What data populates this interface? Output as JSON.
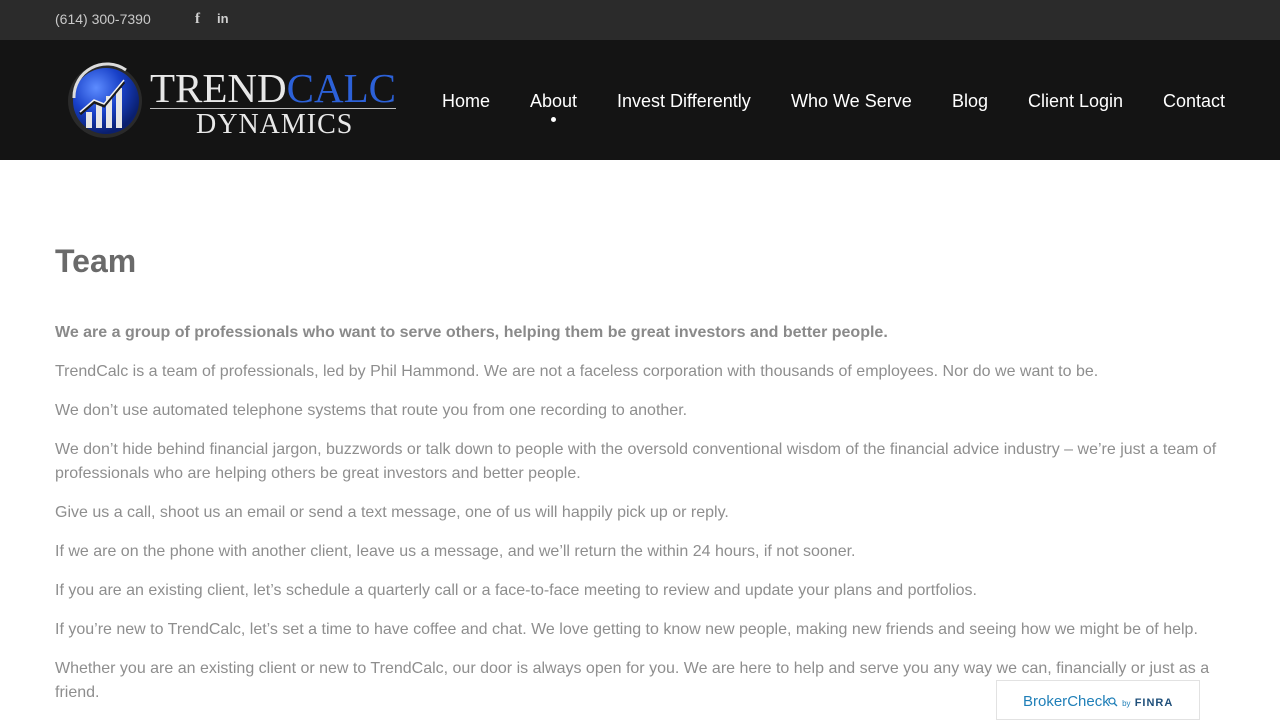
{
  "topbar": {
    "phone": "(614) 300-7390",
    "social": {
      "facebook_glyph": "f",
      "linkedin_glyph": "in"
    }
  },
  "logo": {
    "word_trend": "TREND",
    "word_calc": "CALC",
    "word_dynamics": "DYNAMICS"
  },
  "nav": {
    "items": [
      {
        "label": "Home"
      },
      {
        "label": "About"
      },
      {
        "label": "Invest Differently"
      },
      {
        "label": "Who We Serve"
      },
      {
        "label": "Blog"
      },
      {
        "label": "Client Login"
      },
      {
        "label": "Contact"
      }
    ],
    "active": "About"
  },
  "content": {
    "title": "Team",
    "lead": "We are a group of professionals who want to serve others, helping them be great investors and better people.",
    "paragraphs": [
      "TrendCalc is a team of professionals, led by Phil Hammond. We are not a faceless corporation with thousands of employees. Nor do we want to be.",
      "We don’t use automated telephone systems that route you from one recording to another.",
      "We don’t hide behind financial jargon, buzzwords or talk down to people with the oversold conventional wisdom of the financial advice industry – we’re just a team of professionals who are helping others be great investors and better people.",
      "Give us a call, shoot us an email or send a text message, one of us will happily pick up or reply.",
      "If we are on the phone with another client, leave us a message, and we’ll return the within 24 hours, if not sooner.",
      "If you are an existing client, let’s schedule a quarterly call or a face-to-face meeting to review and update your plans and portfolios.",
      "If you’re new to TrendCalc, let’s set a time to have coffee and chat.  We love getting to know new people, making new friends and seeing how we might be of help.",
      "Whether you are an existing client or new to TrendCalc, our door is always open for you.  We are here to help and serve you any way we can, financially or just as a friend."
    ]
  },
  "brokercheck": {
    "broker": "Broker",
    "check": "Check",
    "by": "by",
    "finra": "FINRA"
  },
  "colors": {
    "topbar_bg": "#2b2b2b",
    "header_bg": "#141414",
    "brand_blue": "#2c61d8",
    "body_text": "#8e8e8e",
    "brokercheck_blue": "#1f7fb8"
  },
  "icons": {
    "globe": "globe-chart-icon",
    "facebook": "facebook-icon",
    "linkedin": "linkedin-icon",
    "magnifier": "magnifier-icon"
  }
}
